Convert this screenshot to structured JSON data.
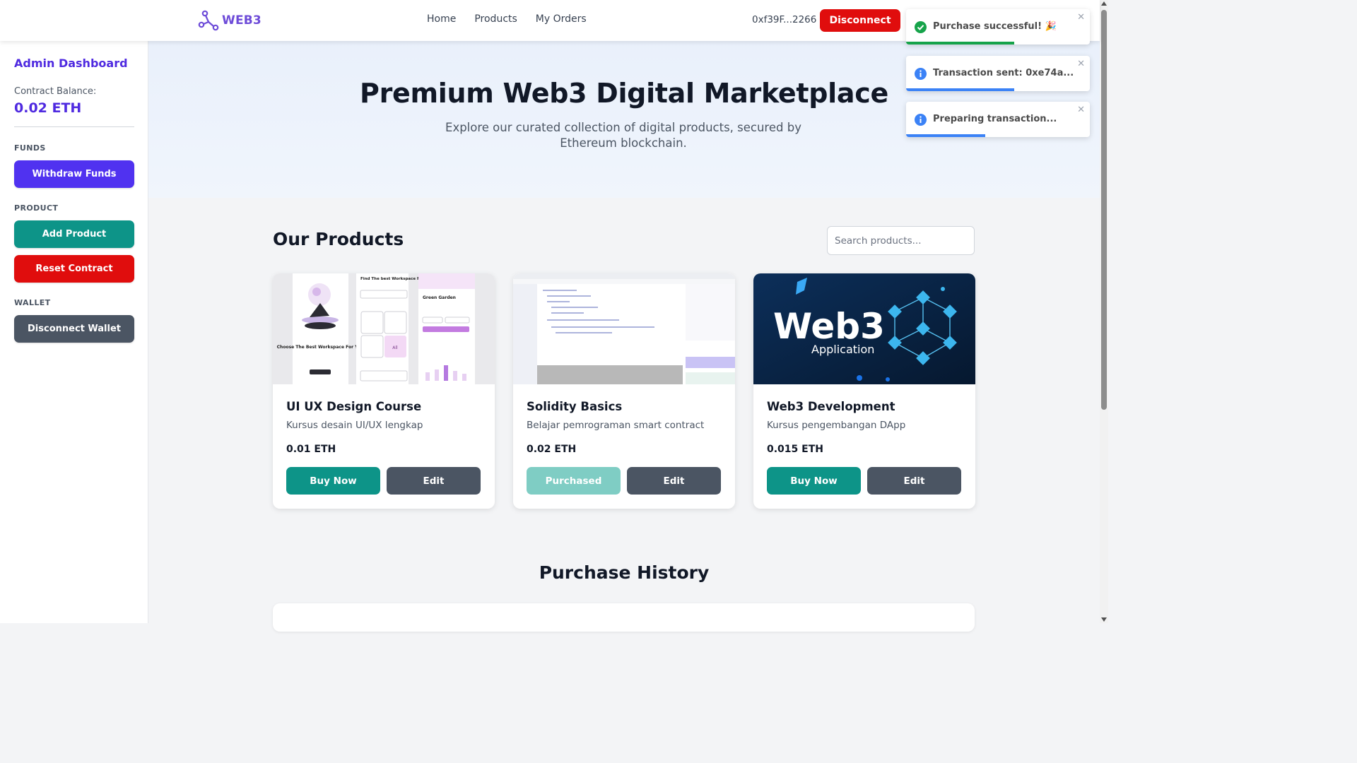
{
  "header": {
    "logo_text": "WEB3",
    "nav": [
      "Home",
      "Products",
      "My Orders"
    ],
    "wallet_address": "0xf39F...2266",
    "disconnect_label": "Disconnect"
  },
  "sidebar": {
    "title": "Admin Dashboard",
    "balance_label": "Contract Balance:",
    "balance_value": "0.02 ETH",
    "sections": {
      "funds": "FUNDS",
      "product": "PRODUCT",
      "wallet": "WALLET"
    },
    "buttons": {
      "withdraw": "Withdraw Funds",
      "add_product": "Add Product",
      "reset": "Reset Contract",
      "disconnect_wallet": "Disconnect Wallet"
    }
  },
  "hero": {
    "title": "Premium Web3 Digital Marketplace",
    "subtitle": "Explore our curated collection of digital products, secured by Ethereum blockchain."
  },
  "products": {
    "section_title": "Our Products",
    "search_placeholder": "Search products...",
    "items": [
      {
        "name": "UI UX Design Course",
        "description": "Kursus desain UI/UX lengkap",
        "price": "0.01 ETH",
        "action": "Buy Now",
        "edit": "Edit",
        "image_texts": [
          "Find The best Workspace For You",
          "Green Garden",
          "Choose The Best Workspace For You",
          "All"
        ]
      },
      {
        "name": "Solidity Basics",
        "description": "Belajar pemrograman smart contract",
        "price": "0.02 ETH",
        "action": "Purchased",
        "edit": "Edit"
      },
      {
        "name": "Web3 Development",
        "description": "Kursus pengembangan DApp",
        "price": "0.015 ETH",
        "action": "Buy Now",
        "edit": "Edit",
        "image_texts": [
          "Web3",
          "Application"
        ]
      }
    ]
  },
  "purchase_history": {
    "title": "Purchase History"
  },
  "toasts": [
    {
      "message": "Purchase successful! 🎉",
      "type": "success",
      "progress": 0.59
    },
    {
      "message": "Transaction sent: 0xe74a...",
      "type": "info",
      "progress": 0.59
    },
    {
      "message": "Preparing transaction...",
      "type": "info",
      "progress": 0.43
    }
  ],
  "colors": {
    "brand_purple": "#4f2ae0",
    "teal": "#0d9488",
    "danger": "#e00d0d",
    "slate": "#4b5563",
    "success": "#16a34a",
    "info": "#3b82f6"
  }
}
